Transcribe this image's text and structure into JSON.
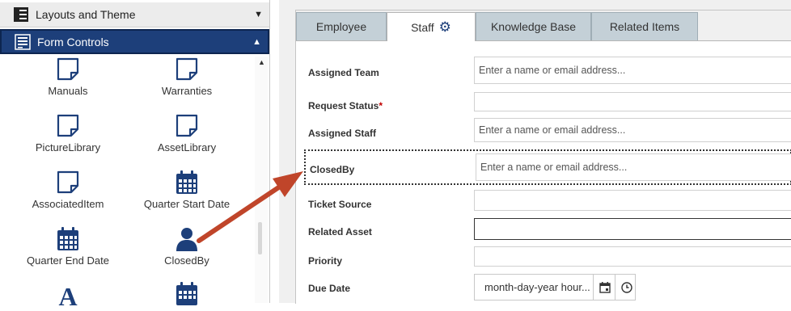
{
  "left_panel": {
    "sections": {
      "layouts_theme": "Layouts and Theme",
      "form_controls": "Form Controls"
    },
    "controls": [
      {
        "label": "Manuals",
        "icon": "page-icon"
      },
      {
        "label": "Warranties",
        "icon": "page-icon"
      },
      {
        "label": "PictureLibrary",
        "icon": "page-icon"
      },
      {
        "label": "AssetLibrary",
        "icon": "page-icon"
      },
      {
        "label": "AssociatedItem",
        "icon": "page-icon"
      },
      {
        "label": "Quarter Start Date",
        "icon": "calendar-icon"
      },
      {
        "label": "Quarter End Date",
        "icon": "calendar-icon"
      },
      {
        "label": "ClosedBy",
        "icon": "person-icon"
      },
      {
        "label": "",
        "icon": "text-icon"
      },
      {
        "label": "",
        "icon": "calendar-icon"
      }
    ]
  },
  "tabs": [
    {
      "label": "Employee",
      "active": false
    },
    {
      "label": "Staff",
      "active": true
    },
    {
      "label": "Knowledge Base",
      "active": false
    },
    {
      "label": "Related Items",
      "active": false
    }
  ],
  "form": {
    "fields": [
      {
        "label": "Assigned Team",
        "placeholder": "Enter a name or email address..."
      },
      {
        "label": "Request Status",
        "required_mark": "*",
        "placeholder": ""
      },
      {
        "label": "Assigned Staff",
        "placeholder": "Enter a name or email address..."
      },
      {
        "label": "ClosedBy",
        "placeholder": "Enter a name or email address..."
      },
      {
        "label": "Ticket Source",
        "placeholder": ""
      },
      {
        "label": "Related Asset",
        "placeholder": ""
      },
      {
        "label": "Priority",
        "placeholder": ""
      },
      {
        "label": "Due Date",
        "date_placeholder": "month-day-year hour..."
      }
    ]
  },
  "colors": {
    "accent_navy": "#1d3f7a",
    "arrow": "#c0452a",
    "tab_inactive": "#c4d0d7"
  }
}
